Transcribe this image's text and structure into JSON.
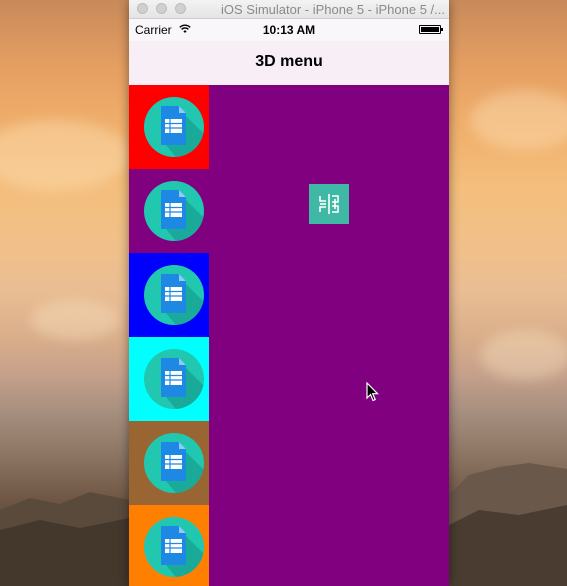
{
  "window": {
    "title": "iOS Simulator - iPhone 5 - iPhone 5 /..."
  },
  "status_bar": {
    "carrier": "Carrier",
    "time": "10:13 AM",
    "wifi_icon": "wifi-icon",
    "battery_icon": "battery-icon"
  },
  "nav": {
    "title": "3D menu"
  },
  "content": {
    "background_color": "#800080"
  },
  "menu": {
    "items": [
      {
        "color": "#ff0000",
        "icon": "document-icon"
      },
      {
        "color": "#800080",
        "icon": "document-icon"
      },
      {
        "color": "#0000ff",
        "icon": "document-icon"
      },
      {
        "color": "#00ffff",
        "icon": "document-icon"
      },
      {
        "color": "#996633",
        "icon": "document-icon"
      },
      {
        "color": "#ff8000",
        "icon": "document-icon"
      }
    ]
  },
  "toggle_button": {
    "icon": "menu-toggle-icon",
    "color": "#3fb9a6"
  }
}
